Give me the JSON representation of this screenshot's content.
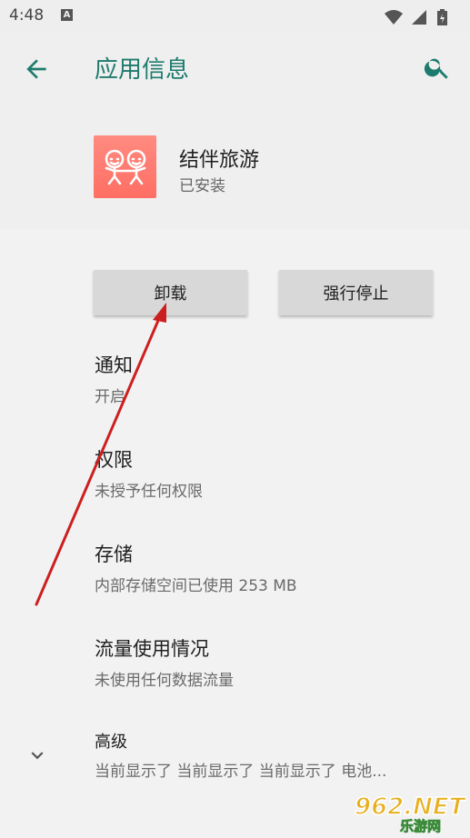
{
  "status_bar": {
    "time": "4:48",
    "notification_icon": "a-icon",
    "right_icons": [
      "wifi-icon",
      "signal-icon",
      "battery-icon"
    ]
  },
  "toolbar": {
    "title": "应用信息",
    "back_icon": "back-arrow-icon",
    "search_icon": "search-icon"
  },
  "app": {
    "name": "结伴旅游",
    "status": "已安装",
    "icon": "app-icon"
  },
  "buttons": {
    "uninstall": "卸载",
    "force_stop": "强行停止"
  },
  "settings": [
    {
      "title": "通知",
      "subtitle": "开启"
    },
    {
      "title": "权限",
      "subtitle": "未授予任何权限"
    },
    {
      "title": "存储",
      "subtitle": "内部存储空间已使用 253 MB"
    },
    {
      "title": "流量使用情况",
      "subtitle": "未使用任何数据流量"
    },
    {
      "title": "高级",
      "subtitle": "当前显示了 当前显示了 当前显示了 电池..."
    }
  ],
  "watermark": {
    "text_top": "962.NET",
    "text_bottom": "乐游网"
  },
  "colors": {
    "accent": "#1d7b6d",
    "arrow": "#cc1f1f"
  }
}
